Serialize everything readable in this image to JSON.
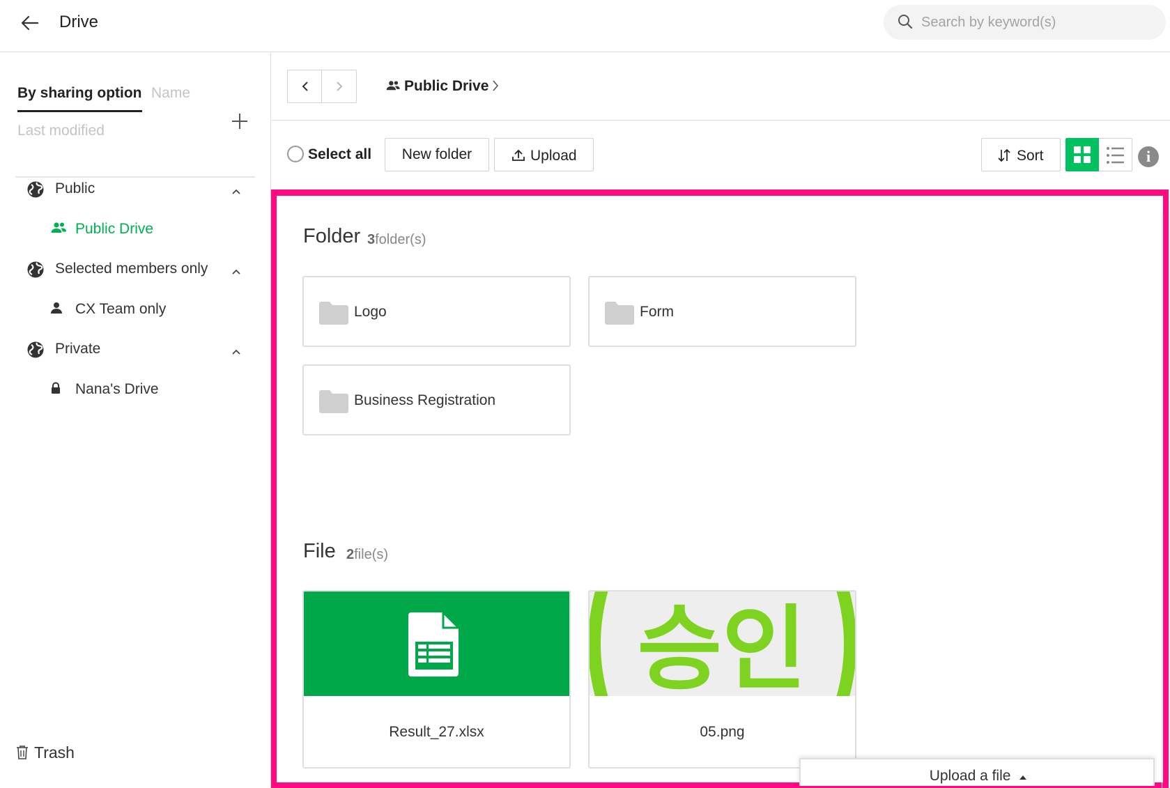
{
  "header": {
    "title": "Drive",
    "search_placeholder": "Search by keyword(s)"
  },
  "sidebar": {
    "sort_tabs": {
      "sharing": "By sharing option",
      "name": "Name",
      "modified": "Last modified"
    },
    "groups": [
      {
        "label": "Public",
        "children": [
          {
            "label": "Public Drive",
            "icon": "people-icon",
            "active": true
          }
        ]
      },
      {
        "label": "Selected members only",
        "children": [
          {
            "label": "CX Team only",
            "icon": "person-icon"
          }
        ]
      },
      {
        "label": "Private",
        "children": [
          {
            "label": "Nana's Drive",
            "icon": "lock-icon"
          }
        ]
      }
    ],
    "trash_label": "Trash"
  },
  "breadcrumb": {
    "current": "Public Drive"
  },
  "toolbar": {
    "select_all": "Select all",
    "new_folder": "New folder",
    "upload": "Upload",
    "sort": "Sort",
    "active_view": "grid"
  },
  "folders": {
    "title": "Folder",
    "count": "3",
    "count_suffix": "folder(s)",
    "items": [
      {
        "name": "Logo"
      },
      {
        "name": "Form"
      },
      {
        "name": "Business Registration"
      }
    ]
  },
  "files": {
    "title": "File",
    "count": "2",
    "count_suffix": "file(s)",
    "items": [
      {
        "name": "Result_27.xlsx",
        "thumb": "spreadsheet-icon"
      },
      {
        "name": "05.png",
        "thumb": "image-preview",
        "preview_text": "승인"
      }
    ]
  },
  "upload_panel": {
    "label": "Upload a file"
  },
  "colors": {
    "accent": "#00c060",
    "xlsx_thumb": "#00a84a",
    "stamp_green": "#7ed321",
    "highlight": "#ff0a80"
  }
}
